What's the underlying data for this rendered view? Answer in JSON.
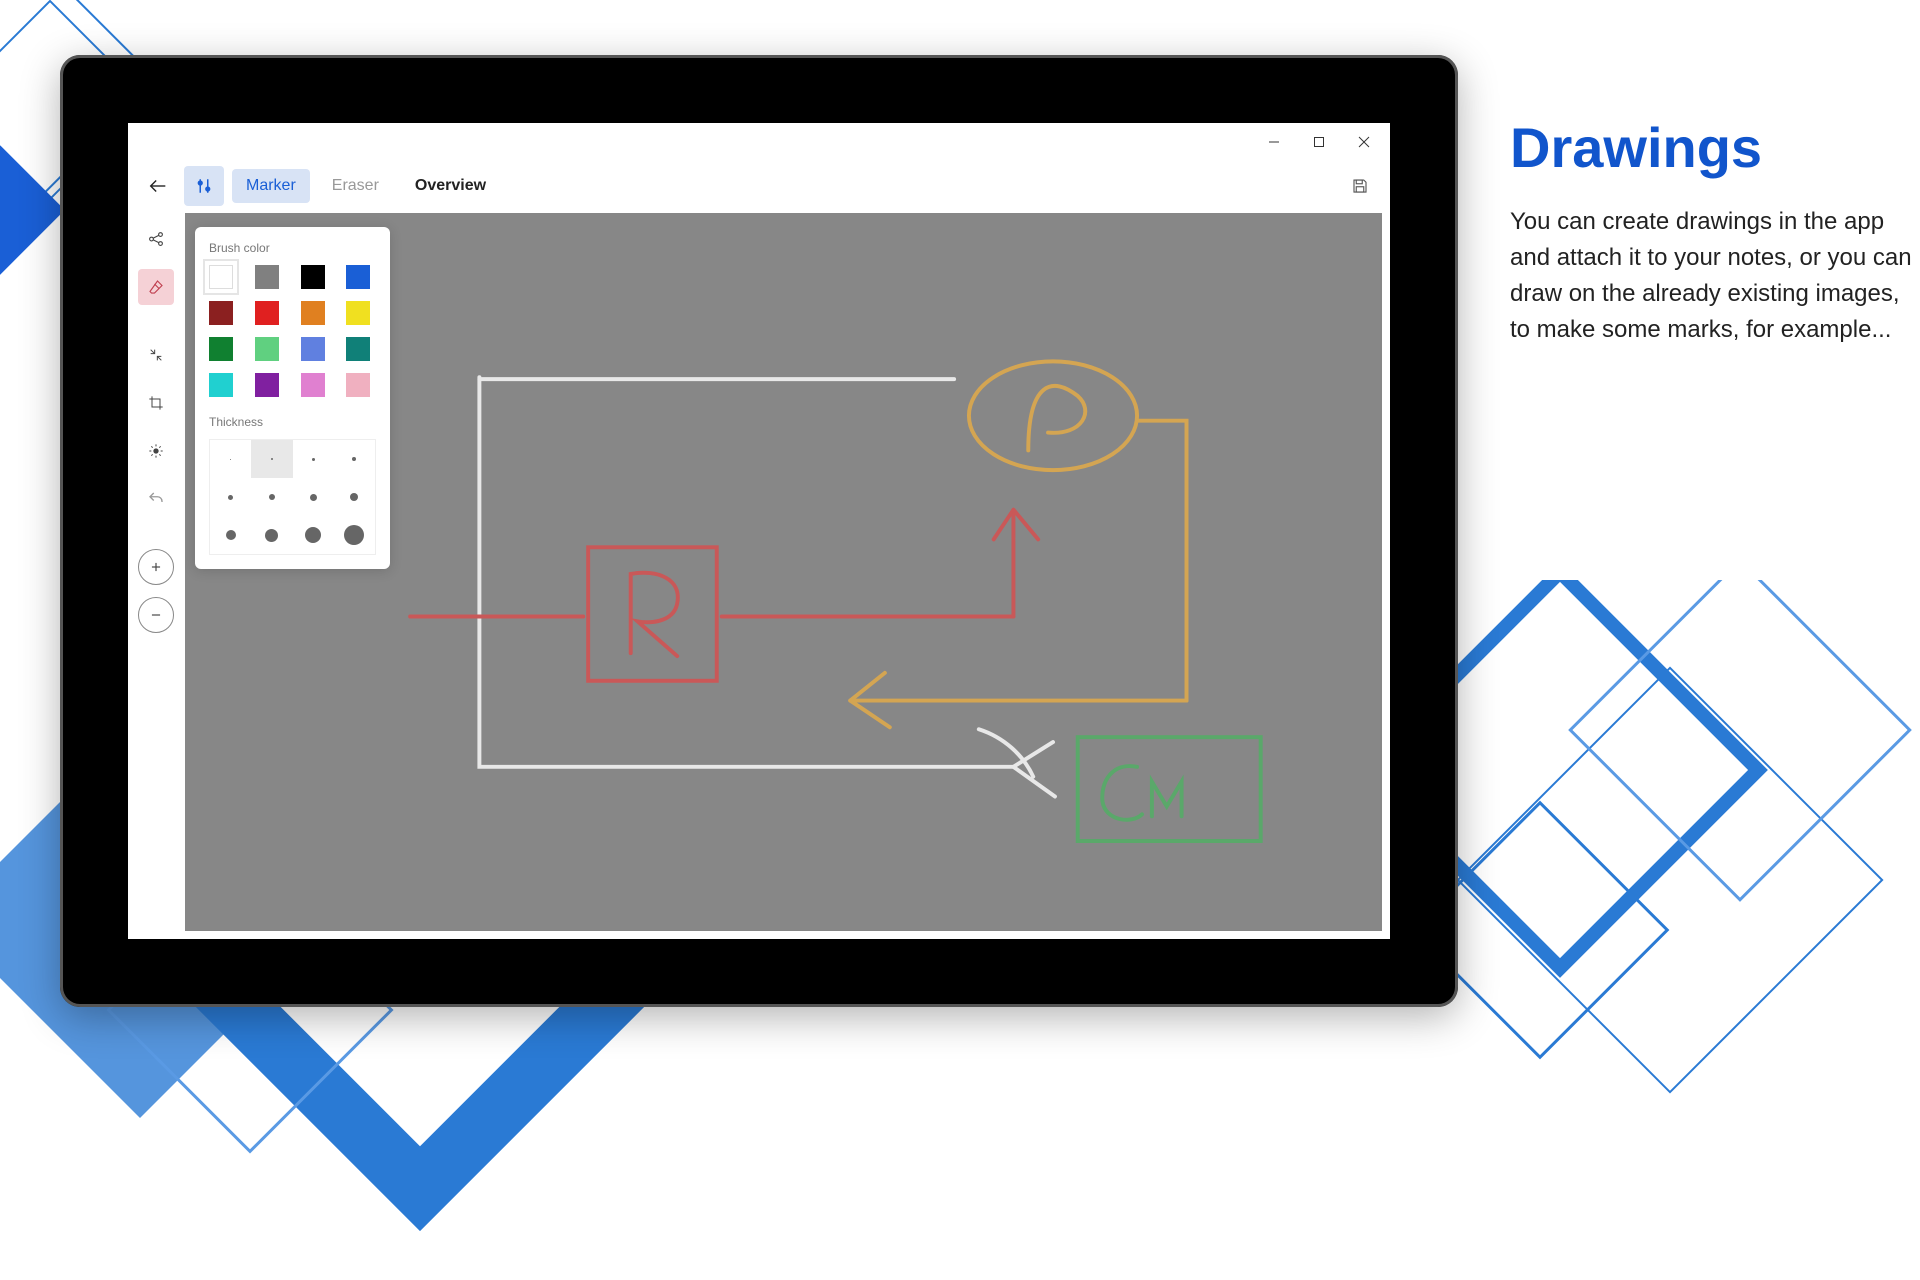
{
  "marketing": {
    "title": "Drawings",
    "body": "You can create drawings in the app and attach it to your notes, or you can draw on the already existing images, to make some marks, for example..."
  },
  "toolbar": {
    "marker_label": "Marker",
    "eraser_label": "Eraser",
    "overview_label": "Overview"
  },
  "brush_panel": {
    "color_label": "Brush color",
    "thickness_label": "Thickness",
    "colors": [
      "#ffffff",
      "#808080",
      "#000000",
      "#1a5fd6",
      "#8b2020",
      "#e02020",
      "#e08020",
      "#f0e020",
      "#108030",
      "#60d080",
      "#6080e0",
      "#108078",
      "#20d0d0",
      "#8020a0",
      "#e080d0",
      "#f0b0c0"
    ],
    "selected_color_index": 0,
    "thickness_sizes_px": [
      1,
      2,
      3,
      4,
      5,
      6,
      7,
      8,
      10,
      13,
      16,
      20
    ],
    "selected_thickness_index": 1
  },
  "canvas": {
    "strokes": {
      "white_frame": "white rectangular frame with arrow bottom-right",
      "red_box_label": "R",
      "orange_circle_label": "P",
      "green_box_label": "Cm"
    }
  }
}
